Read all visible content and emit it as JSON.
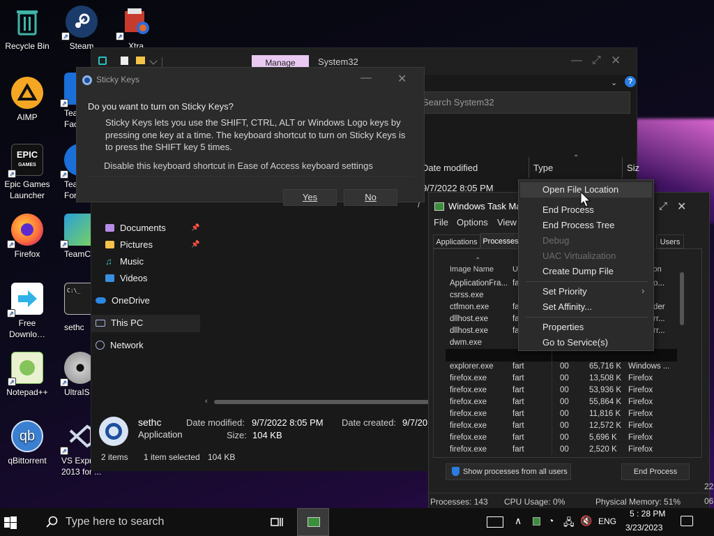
{
  "desktop": {
    "icons": [
      {
        "name": "recycle-bin-icon",
        "label": "Recycle Bin",
        "color": "#3fb6a8"
      },
      {
        "name": "steam-icon",
        "label": "Steam",
        "color": "#1b3c6b"
      },
      {
        "name": "xtra-icon",
        "label": "Xtra",
        "color": "#c73b2e"
      },
      {
        "name": "aimp-icon",
        "label": "AIMP",
        "color": "#f5a623"
      },
      {
        "name": "teamviewer-facade-icon",
        "label": "Tea Face",
        "color": "#1a6fd8"
      },
      {
        "name": "epic-games-icon",
        "label": "Epic Games Launcher",
        "color": "#111111"
      },
      {
        "name": "teams-forum-icon",
        "label": "Tea Foru",
        "color": "#1a6fd8"
      },
      {
        "name": "firefox-icon",
        "label": "Firefox",
        "color": "#ff7139"
      },
      {
        "name": "teamcity-icon",
        "label": "TeamC",
        "color": "#2aa0d8"
      },
      {
        "name": "free-download-icon",
        "label": "Free Downlo…",
        "color": "#2fb2e8"
      },
      {
        "name": "sethc-shortcut-icon",
        "label": "sethc",
        "color": "#1e1e1e"
      },
      {
        "name": "notepad-plus-plus-icon",
        "label": "Notepad++",
        "color": "#84c45a"
      },
      {
        "name": "ultraiso-icon",
        "label": "UltraIS",
        "color": "#9b9b9b"
      },
      {
        "name": "qbittorrent-icon",
        "label": "qBittorrent",
        "color": "#3a7fd0"
      },
      {
        "name": "vs-express-icon",
        "label": "VS Expr 2013 for ...",
        "color": "#2a5a9a"
      }
    ]
  },
  "explorer": {
    "ribbon_tab": "Manage",
    "title": "System32",
    "search_placeholder": "Search System32",
    "columns": {
      "date_modified": "Date modified",
      "type": "Type",
      "size": "Siz"
    },
    "first_row_date": "9/7/2022 8:05 PM",
    "nav": {
      "documents": "Documents",
      "pictures": "Pictures",
      "music": "Music",
      "videos": "Videos",
      "onedrive": "OneDrive",
      "this_pc": "This PC",
      "network": "Network"
    },
    "details": {
      "name": "sethc",
      "kind": "Application",
      "date_modified_label": "Date modified:",
      "date_modified": "9/7/2022 8:05 PM",
      "date_created_label": "Date created:",
      "date_created": "9/7/20",
      "size_label": "Size:",
      "size": "104 KB"
    },
    "status": {
      "count": "2 items",
      "selected": "1 item selected",
      "selected_size": "104 KB"
    }
  },
  "sticky": {
    "title": "Sticky Keys",
    "question": "Do you want to turn on Sticky Keys?",
    "body": "Sticky Keys lets you use the SHIFT, CTRL, ALT or Windows Logo keys by pressing one key at a time. The keyboard shortcut to turn on Sticky Keys is to press the SHIFT key 5 times.",
    "link": "Disable this keyboard shortcut in Ease of Access keyboard settings",
    "yes": "Yes",
    "no": "No"
  },
  "taskmgr": {
    "title": "Windows Task Ma",
    "menu": {
      "file": "File",
      "options": "Options",
      "view": "View"
    },
    "tabs": {
      "applications": "Applications",
      "processes": "Processes",
      "users": "Users"
    },
    "col_image": "Image Name",
    "col_user": "Us",
    "col_desc": "tion",
    "top_rows": [
      {
        "name": "ApplicationFra...",
        "user": "fa",
        "desc": "o..."
      },
      {
        "name": "csrss.exe",
        "user": "",
        "desc": ""
      },
      {
        "name": "ctfmon.exe",
        "user": "fa",
        "desc": "der"
      },
      {
        "name": "dllhost.exe",
        "user": "fa",
        "desc": "rr..."
      },
      {
        "name": "dllhost.exe",
        "user": "fa",
        "desc": "rr..."
      },
      {
        "name": "dwm.exe",
        "user": "",
        "desc": ""
      }
    ],
    "rows": [
      {
        "name": "explorer.exe",
        "user": "fart",
        "cpu": "00",
        "mem": "65,716 K",
        "desc": "Windows ..."
      },
      {
        "name": "firefox.exe",
        "user": "fart",
        "cpu": "00",
        "mem": "13,508 K",
        "desc": "Firefox"
      },
      {
        "name": "firefox.exe",
        "user": "fart",
        "cpu": "00",
        "mem": "53,936 K",
        "desc": "Firefox"
      },
      {
        "name": "firefox.exe",
        "user": "fart",
        "cpu": "00",
        "mem": "55,864 K",
        "desc": "Firefox"
      },
      {
        "name": "firefox.exe",
        "user": "fart",
        "cpu": "00",
        "mem": "11,816 K",
        "desc": "Firefox"
      },
      {
        "name": "firefox.exe",
        "user": "fart",
        "cpu": "00",
        "mem": "12,572 K",
        "desc": "Firefox"
      },
      {
        "name": "firefox.exe",
        "user": "fart",
        "cpu": "00",
        "mem": "5,696 K",
        "desc": "Firefox"
      },
      {
        "name": "firefox.exe",
        "user": "fart",
        "cpu": "00",
        "mem": "2,520 K",
        "desc": "Firefox"
      }
    ],
    "show_all": "Show processes from all users",
    "end_process": "End Process",
    "status": {
      "processes": "Processes: 143",
      "cpu": "CPU Usage: 0%",
      "memory": "Physical Memory: 51%"
    }
  },
  "context_menu": {
    "open_location": "Open File Location",
    "end_process": "End Process",
    "end_tree": "End Process Tree",
    "debug": "Debug",
    "uac": "UAC Virtualization",
    "dump": "Create Dump File",
    "priority": "Set Priority",
    "affinity": "Set Affinity...",
    "properties": "Properties",
    "services": "Go to Service(s)"
  },
  "taskbar": {
    "search_placeholder": "Type here to search",
    "lang": "ENG",
    "time": "5 : 28 PM",
    "date": "3/23/2023"
  },
  "edge": {
    "top": "22",
    "bottom": "06"
  }
}
